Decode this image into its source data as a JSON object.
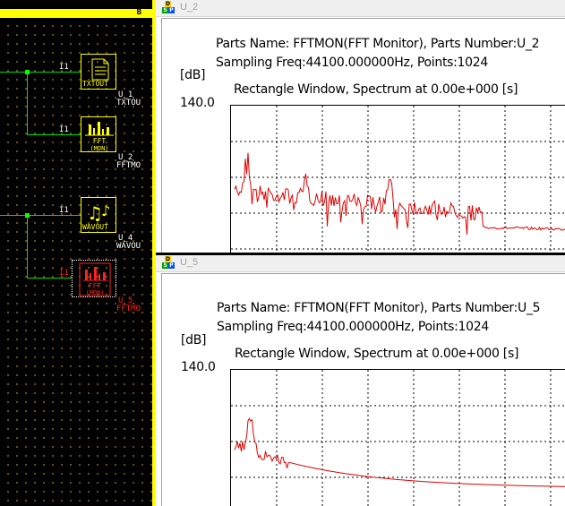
{
  "schematic": {
    "corner_label": "B",
    "blocks": [
      {
        "symbol": "TXTOUT",
        "pin": "I1",
        "ref": "U_1",
        "type": "TXTOU",
        "selected": false
      },
      {
        "symbol": "FFT\n(MON)",
        "pin": "I1",
        "ref": "U_2",
        "type": "FFTMO",
        "selected": false
      },
      {
        "symbol": "WAVOUT",
        "pin": "I1",
        "ref": "U_4",
        "type": "WAVOU",
        "selected": false
      },
      {
        "symbol": "FFT\n(MON)",
        "pin": "I1",
        "ref": "U_5",
        "type": "FFTMO",
        "selected": true
      }
    ]
  },
  "windows": [
    {
      "title": "U_2",
      "icon_letters": [
        "D",
        "S",
        "P"
      ],
      "parts_line": "Parts Name: FFTMON(FFT Monitor), Parts Number:U_2",
      "sampling_line": "Sampling Freq:44100.000000Hz, Points:1024",
      "unit": "[dB]",
      "window_line": "Rectangle Window, Spectrum at 0.00e+000 [s]",
      "ymax": "140.0"
    },
    {
      "title": "U_5",
      "icon_letters": [
        "D",
        "S",
        "P"
      ],
      "parts_line": "Parts Name: FFTMON(FFT Monitor), Parts Number:U_5",
      "sampling_line": "Sampling Freq:44100.000000Hz, Points:1024",
      "unit": "[dB]",
      "window_line": "Rectangle Window, Spectrum at 0.00e+000 [s]",
      "ymax": "140.0"
    }
  ],
  "colors": {
    "trace": "#e00000",
    "wire": "#00e000",
    "block": "#ffff00",
    "selected_block": "#ff2020"
  }
}
